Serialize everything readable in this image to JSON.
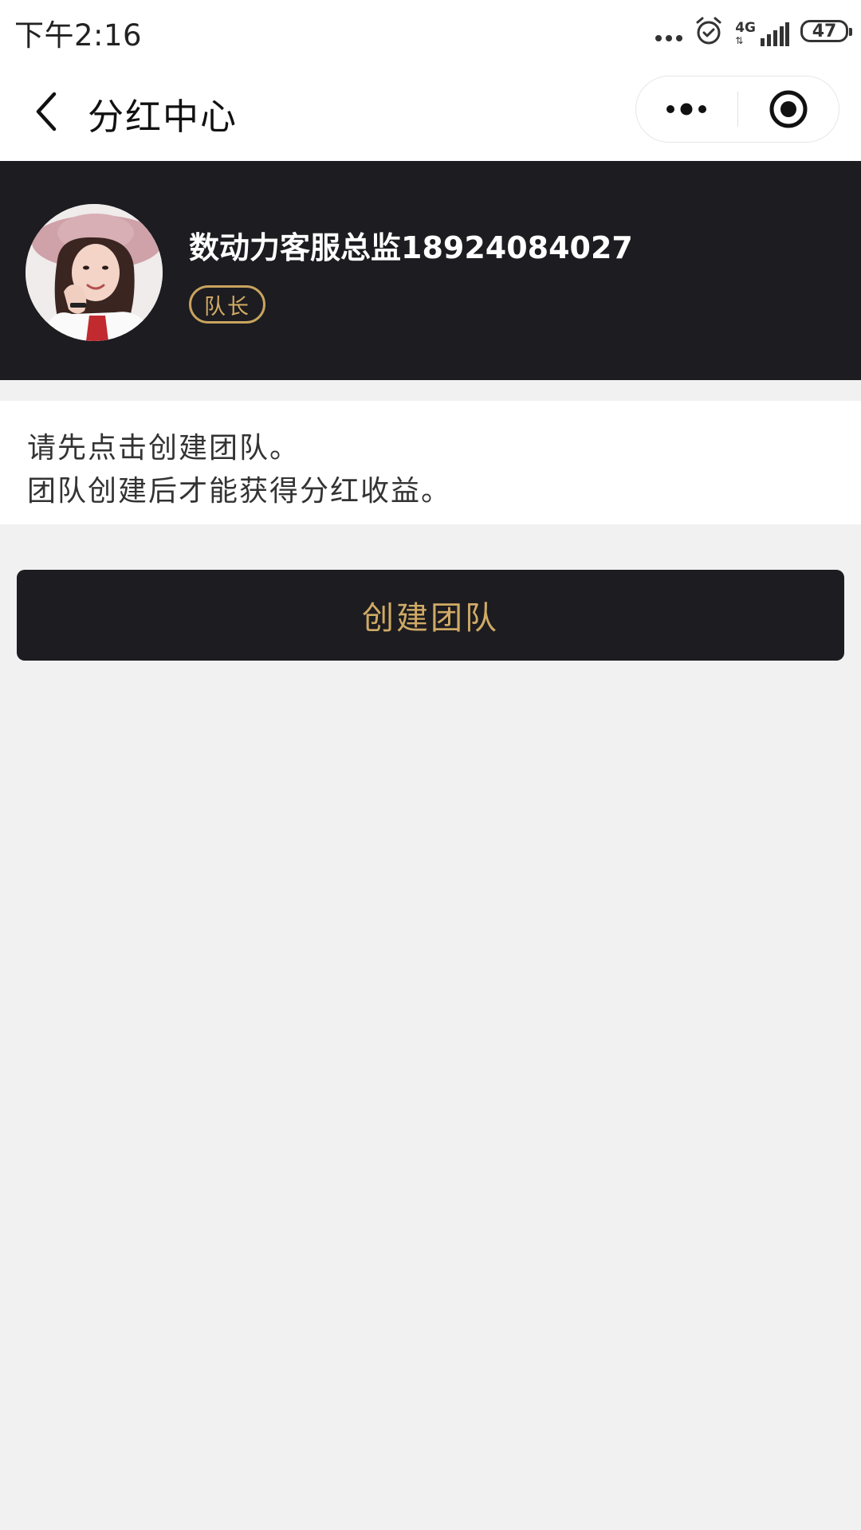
{
  "status_bar": {
    "time": "下午2:16",
    "network": "4G",
    "battery": "47"
  },
  "nav": {
    "title": "分红中心"
  },
  "profile": {
    "name": "数动力客服总监18924084027",
    "role": "队长"
  },
  "notice": {
    "line1": "请先点击创建团队。",
    "line2": "团队创建后才能获得分红收益。"
  },
  "actions": {
    "create_team_label": "创建团队"
  },
  "colors": {
    "dark_panel": "#1c1c21",
    "gold_accent": "#d0aa65",
    "page_background": "#f1f1f2"
  },
  "icons": {
    "back": "back-chevron-icon",
    "more": "more-dots-icon",
    "close": "target-close-icon",
    "alarm": "alarm-clock-icon",
    "signal": "signal-bars-icon",
    "battery": "battery-icon"
  }
}
